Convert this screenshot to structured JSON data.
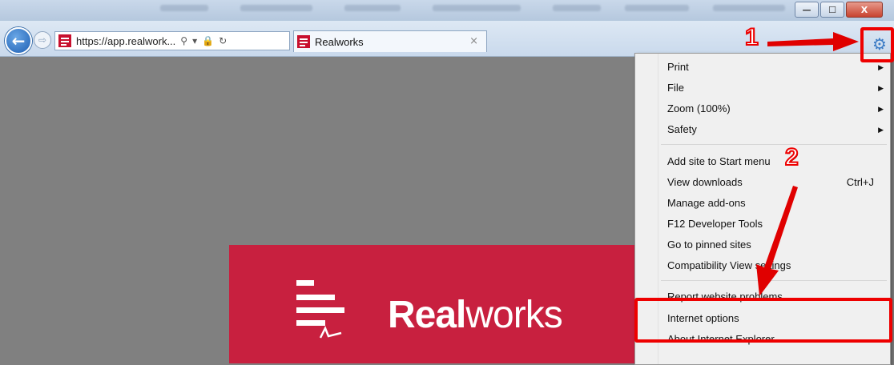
{
  "browser": {
    "url": "https://app.realwork...",
    "tab_title": "Realworks",
    "tab_close": "×",
    "window_controls": {
      "minimize": "—",
      "maximize": "☐",
      "close": "X"
    },
    "icons": [
      "back-arrow-icon",
      "forward-arrow-icon",
      "search-icon",
      "dropdown-icon",
      "lock-icon",
      "refresh-icon",
      "gear-icon"
    ]
  },
  "brand": {
    "name_bold": "Real",
    "name_light": "works",
    "color": "#c8203f"
  },
  "menu": {
    "items": [
      {
        "label": "Print",
        "submenu": true
      },
      {
        "label": "File",
        "submenu": true
      },
      {
        "label": "Zoom (100%)",
        "submenu": true
      },
      {
        "label": "Safety",
        "submenu": true
      },
      {
        "label": "Add site to Start menu"
      },
      {
        "label": "View downloads",
        "shortcut": "Ctrl+J"
      },
      {
        "label": "Manage add-ons"
      },
      {
        "label": "F12 Developer Tools"
      },
      {
        "label": "Go to pinned sites"
      },
      {
        "label": "Compatibility View settings"
      },
      {
        "label": "Report website problems"
      },
      {
        "label": "Internet options"
      },
      {
        "label": "About Internet Explorer"
      }
    ]
  },
  "annotations": {
    "step1": "1",
    "step2": "2",
    "color": "#e00000"
  }
}
